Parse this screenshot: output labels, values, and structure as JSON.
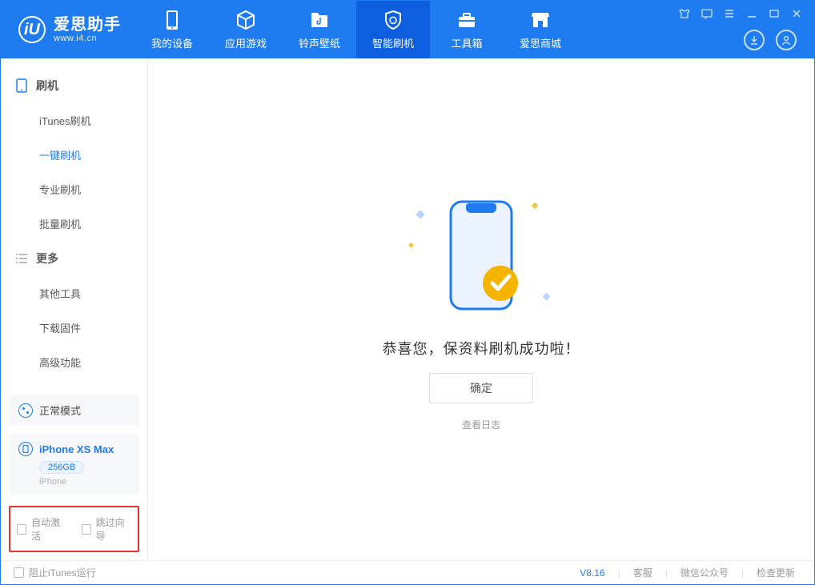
{
  "brand": {
    "title": "爱思助手",
    "subtitle": "www.i4.cn",
    "logo_letter": "iU"
  },
  "header": {
    "tabs": [
      {
        "label": "我的设备"
      },
      {
        "label": "应用游戏"
      },
      {
        "label": "铃声壁纸"
      },
      {
        "label": "智能刷机"
      },
      {
        "label": "工具箱"
      },
      {
        "label": "爱思商城"
      }
    ]
  },
  "sidebar": {
    "section1_title": "刷机",
    "section1_items": [
      "iTunes刷机",
      "一键刷机",
      "专业刷机",
      "批量刷机"
    ],
    "section2_title": "更多",
    "section2_items": [
      "其他工具",
      "下载固件",
      "高级功能"
    ]
  },
  "device": {
    "mode_label": "正常模式",
    "name": "iPhone XS Max",
    "storage": "256GB",
    "type": "iPhone"
  },
  "options": {
    "auto_activate": "自动激活",
    "skip_guide": "跳过向导"
  },
  "main": {
    "message": "恭喜您，保资料刷机成功啦！",
    "ok_label": "确定",
    "view_log": "查看日志"
  },
  "footer": {
    "block_itunes": "阻止iTunes运行",
    "version": "V8.16",
    "links": [
      "客服",
      "微信公众号",
      "检查更新"
    ]
  }
}
